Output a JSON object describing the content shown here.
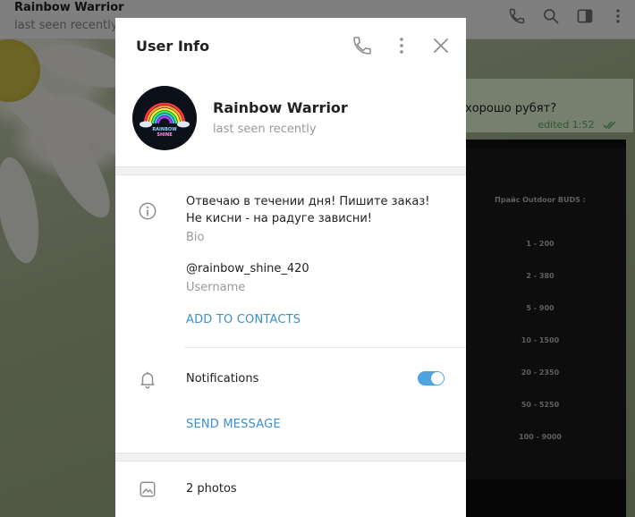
{
  "chat_header": {
    "title": "Rainbow Warrior",
    "status": "last seen recently",
    "icons": [
      "phone-icon",
      "search-icon",
      "sidebar-toggle-icon",
      "more-vertical-icon"
    ]
  },
  "chat": {
    "message_text": "хорошо рубят?",
    "message_meta": "edited 1:52",
    "photo": {
      "title": "Прайс Outdoor BUDS :",
      "prices": [
        "1 - 200",
        "2 - 380",
        "5 - 900",
        "10 - 1500",
        "20 - 2350",
        "50 - 5250",
        "100 - 9000"
      ]
    }
  },
  "modal": {
    "title": "User Info",
    "icons": [
      "phone-icon",
      "more-vertical-icon",
      "close-icon"
    ],
    "profile": {
      "name": "Rainbow Warrior",
      "status": "last seen recently",
      "avatar_text_1": "RAINBOW",
      "avatar_text_2": "SHINE"
    },
    "bio": {
      "text": "Отвечаю в течении дня! Пишите заказ! Не кисни - на радуге зависни!",
      "label": "Bio"
    },
    "username": {
      "value": "@rainbow_shine_420",
      "label": "Username"
    },
    "add_contacts_label": "ADD TO CONTACTS",
    "notifications": {
      "label": "Notifications",
      "enabled": true
    },
    "send_message_label": "SEND MESSAGE",
    "photos_label": "2 photos"
  },
  "colors": {
    "accent": "#3a8fd0",
    "toggle_on": "#4ea4e0",
    "read_check": "#5fb36a"
  }
}
